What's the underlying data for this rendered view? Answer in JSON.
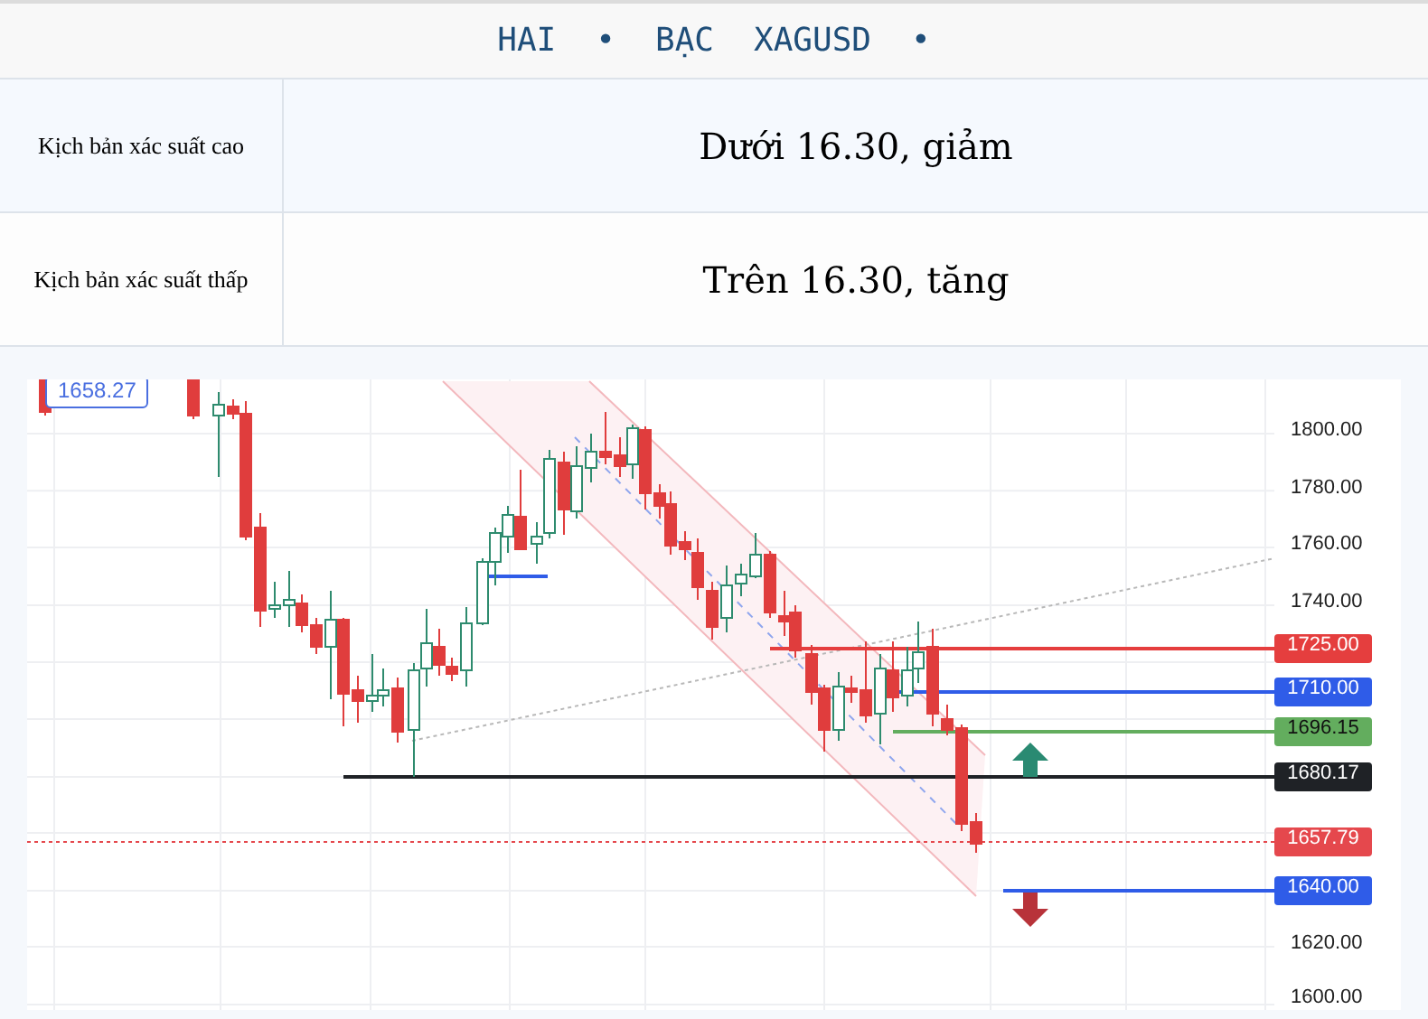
{
  "header": {
    "title_parts": [
      "HAI",
      "•",
      "BẠC",
      "XAGUSD",
      "•"
    ]
  },
  "scenarios": [
    {
      "label": "Kịch bản xác suất cao",
      "value": "Dưới 16.30, giảm"
    },
    {
      "label": "Kịch bản xác suất thấp",
      "value": "Trên 16.30, tăng"
    }
  ],
  "chart": {
    "price_badge": "1658.27",
    "axis_labels": [
      "1800.00",
      "1780.00",
      "1760.00",
      "1740.00",
      "1620.00",
      "1600.00"
    ],
    "price_tags": [
      {
        "text": "1725.00",
        "color": "#e53e3e",
        "kind": "light"
      },
      {
        "text": "1710.00",
        "color": "#2f5ce8",
        "kind": "light"
      },
      {
        "text": "1696.15",
        "color": "#63ad5e",
        "kind": "dark"
      },
      {
        "text": "1680.17",
        "color": "#1f2226",
        "kind": "light"
      },
      {
        "text": "1657.79",
        "color": "#e5484d",
        "kind": "light"
      },
      {
        "text": "1640.00",
        "color": "#2f5ce8",
        "kind": "light"
      }
    ]
  }
}
